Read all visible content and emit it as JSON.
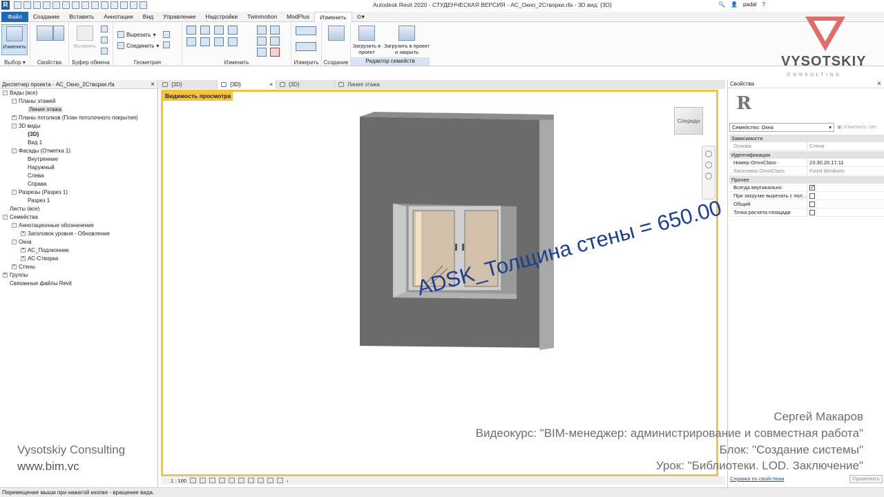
{
  "titlebar": {
    "title": "Autodesk Revit 2020 - СТУДЕНЧЕСКАЯ ВЕРСИЯ - АС_Окно_2Створки.rfa - 3D вид: {3D}",
    "user": "padal"
  },
  "tabs": [
    "Файл",
    "Создание",
    "Вставить",
    "Аннотации",
    "Вид",
    "Управление",
    "Надстройки",
    "Twinmotion",
    "ModPlus",
    "Изменить"
  ],
  "ribbon": {
    "modify_label": "Изменить",
    "paste_label": "Вставить",
    "cut_label": "Вырезать",
    "join_label": "Соединить",
    "load_project_label": "Загрузить в проект",
    "load_close_label": "Загрузить в проект и закрыть",
    "groups": {
      "select": "Выбор",
      "properties": "Свойства",
      "clipboard": "Буфер обмена",
      "geometry": "Геометрия",
      "modify": "Изменить",
      "measure": "Измерить",
      "create": "Создание",
      "family_editor": "Редактор семейств"
    }
  },
  "browser": {
    "title": "Диспетчер проекта - АС_Окно_2Створки.rfa",
    "items": [
      {
        "label": "Виды (все)",
        "level": 0,
        "toggle": "-"
      },
      {
        "label": "Планы этажей",
        "level": 1,
        "toggle": "-"
      },
      {
        "label": "Линия этажа",
        "level": 2,
        "toggle": "",
        "selected": true
      },
      {
        "label": "Планы потолков (План потолочного покрытия)",
        "level": 1,
        "toggle": "+"
      },
      {
        "label": "3D виды",
        "level": 1,
        "toggle": "-"
      },
      {
        "label": "{3D}",
        "level": 2,
        "toggle": "",
        "bold": true
      },
      {
        "label": "Вид 1",
        "level": 2,
        "toggle": ""
      },
      {
        "label": "Фасады (Отметка 1)",
        "level": 1,
        "toggle": "-"
      },
      {
        "label": "Внутренние",
        "level": 2,
        "toggle": ""
      },
      {
        "label": "Наружный",
        "level": 2,
        "toggle": ""
      },
      {
        "label": "Слева",
        "level": 2,
        "toggle": ""
      },
      {
        "label": "Справа",
        "level": 2,
        "toggle": ""
      },
      {
        "label": "Разрезы (Разрез 1)",
        "level": 1,
        "toggle": "-"
      },
      {
        "label": "Разрез 1",
        "level": 2,
        "toggle": ""
      },
      {
        "label": "Листы (все)",
        "level": 0,
        "toggle": ""
      },
      {
        "label": "Семейства",
        "level": 0,
        "toggle": "-"
      },
      {
        "label": "Аннотационные обозначения",
        "level": 1,
        "toggle": "-"
      },
      {
        "label": "Заголовок уровня - Обновление",
        "level": 2,
        "toggle": "+"
      },
      {
        "label": "Окна",
        "level": 1,
        "toggle": "-"
      },
      {
        "label": "АС_Подоконник",
        "level": 2,
        "toggle": "+"
      },
      {
        "label": "АС-Створка",
        "level": 2,
        "toggle": "+"
      },
      {
        "label": "Стены",
        "level": 1,
        "toggle": "+"
      },
      {
        "label": "Группы",
        "level": 0,
        "toggle": "+"
      },
      {
        "label": "Связанные файлы Revit",
        "level": 0,
        "toggle": ""
      }
    ]
  },
  "viewtabs": [
    {
      "label": "{3D}",
      "active": false
    },
    {
      "label": "{3D}",
      "active": true
    },
    {
      "label": "{3D}",
      "active": false
    },
    {
      "label": "Линия этажа",
      "active": false
    }
  ],
  "viewport": {
    "visibility_label": "Видимость просмотра",
    "navcube_label": "Спереди",
    "scale": "1 : 100",
    "param_text": "ADSK_Толщина стены = 650.00"
  },
  "properties": {
    "title": "Свойства",
    "family_selector": "Семейство: Окна",
    "edit_type": "Изменить тип",
    "sections": [
      {
        "name": "Зависимости",
        "rows": [
          {
            "k": "Основа",
            "v": "Стена",
            "dim": true
          }
        ]
      },
      {
        "name": "Идентификация",
        "rows": [
          {
            "k": "Номер OmniClass",
            "v": "23.30.20.17.11"
          },
          {
            "k": "Заголовок OmniClass",
            "v": "Fixed Windows",
            "dim": true
          }
        ]
      },
      {
        "name": "Прочее",
        "rows": [
          {
            "k": "Всегда вертикально",
            "cb": true
          },
          {
            "k": "При загрузке вырезать с пол...",
            "cb": false
          },
          {
            "k": "Общий",
            "cb": false
          },
          {
            "k": "Точка расчета площади",
            "cb": false
          }
        ]
      }
    ],
    "help": "Справка по свойствам",
    "apply": "Применить"
  },
  "statusbar": {
    "text": "Перемещение мыши при нажатой кнопке - вращение вида."
  },
  "overlay": {
    "logo_name": "VYSOTSKIY",
    "logo_sub": "CONSULTING",
    "brand": "Vysotskiy Consulting",
    "site": "www.bim.vc",
    "author": "Сергей Макаров",
    "course": "Видеокурс: \"BIM-менеджер: администрирование и совместная работа\"",
    "block": "Блок: \"Создание системы\"",
    "lesson": "Урок: \"Библиотеки. LOD. Заключение\""
  },
  "colors": {
    "accent": "#1f6ab8",
    "viewport_border": "#f5c242",
    "param_text": "#1c3f8f",
    "wall": "#6b6b6b"
  }
}
